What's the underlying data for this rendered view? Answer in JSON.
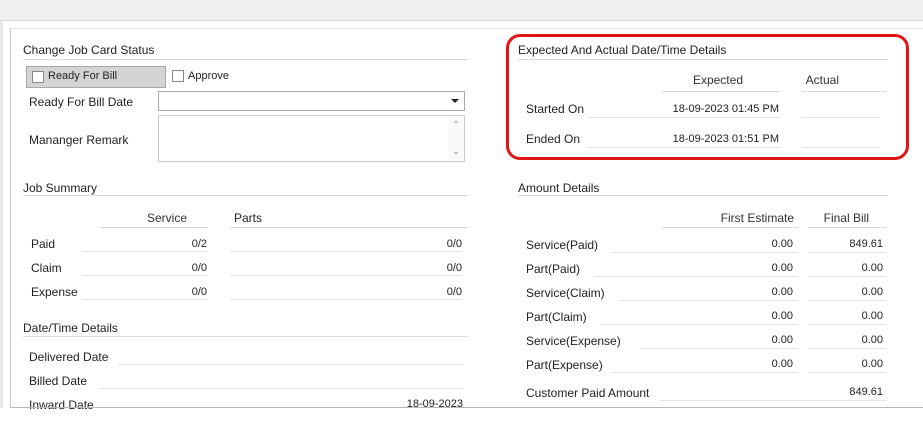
{
  "status": {
    "title": "Change Job Card Status",
    "ready_for_bill_label": "Ready For Bill",
    "approve_label": "Approve",
    "ready_for_bill_date_label": "Ready For Bill Date",
    "ready_for_bill_date_value": "",
    "manager_remark_label": "Mananger Remark",
    "manager_remark_value": ""
  },
  "expected_actual": {
    "title": "Expected And Actual Date/Time Details",
    "col_expected": "Expected",
    "col_actual": "Actual",
    "rows": [
      {
        "label": "Started On",
        "expected": "18-09-2023 01:45 PM",
        "actual": ""
      },
      {
        "label": "Ended On",
        "expected": "18-09-2023 01:51 PM",
        "actual": ""
      }
    ]
  },
  "job_summary": {
    "title": "Job Summary",
    "col_service": "Service",
    "col_parts": "Parts",
    "rows": [
      {
        "label": "Paid",
        "service": "0/2",
        "parts": "0/0"
      },
      {
        "label": "Claim",
        "service": "0/0",
        "parts": "0/0"
      },
      {
        "label": "Expense",
        "service": "0/0",
        "parts": "0/0"
      }
    ]
  },
  "datetime_details": {
    "title": "Date/Time Details",
    "rows": [
      {
        "label": "Delivered Date",
        "value": ""
      },
      {
        "label": "Billed Date",
        "value": ""
      },
      {
        "label": "Inward Date",
        "value": "18-09-2023"
      }
    ]
  },
  "amount_details": {
    "title": "Amount Details",
    "col_first_estimate": "First Estimate",
    "col_final_bill": "Final Bill",
    "rows": [
      {
        "label": "Service(Paid)",
        "first_estimate": "0.00",
        "final_bill": "849.61"
      },
      {
        "label": "Part(Paid)",
        "first_estimate": "0.00",
        "final_bill": "0.00"
      },
      {
        "label": "Service(Claim)",
        "first_estimate": "0.00",
        "final_bill": "0.00"
      },
      {
        "label": "Part(Claim)",
        "first_estimate": "0.00",
        "final_bill": "0.00"
      },
      {
        "label": "Service(Expense)",
        "first_estimate": "0.00",
        "final_bill": "0.00"
      },
      {
        "label": "Part(Expense)",
        "first_estimate": "0.00",
        "final_bill": "0.00"
      }
    ],
    "customer_paid_label": "Customer Paid Amount",
    "customer_paid_value": "849.61"
  },
  "colors": {
    "highlight_border": "#e01616",
    "button_bg": "#d4d4d4"
  }
}
